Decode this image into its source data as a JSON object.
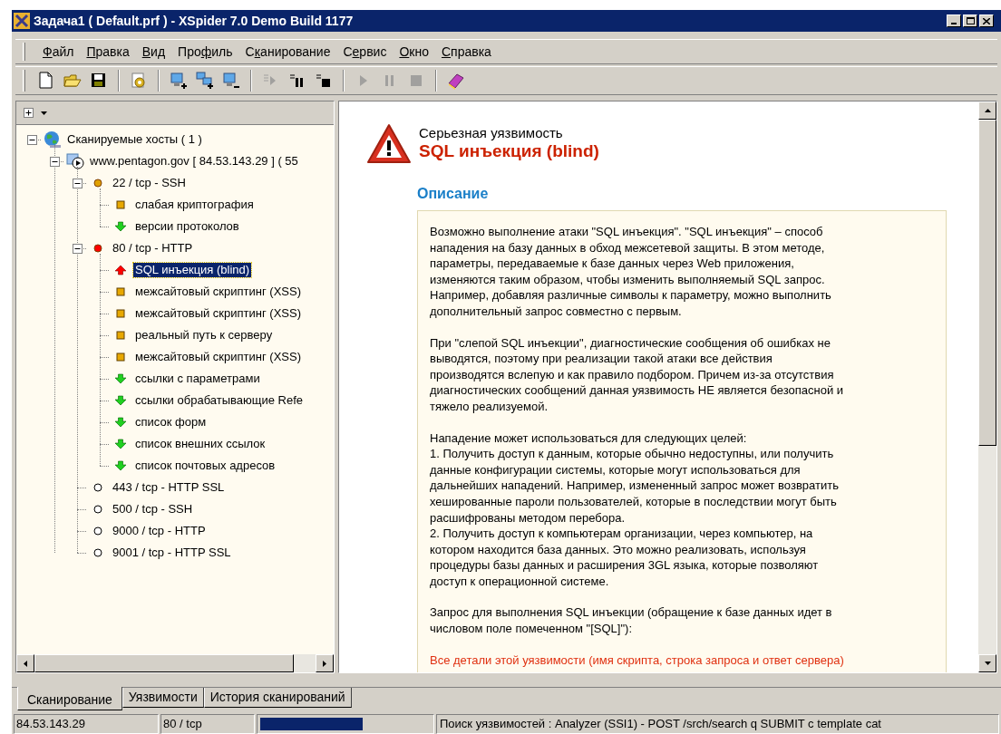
{
  "window": {
    "title": "Задача1 ( Default.prf ) - XSpider 7.0 Demo Build 1177"
  },
  "menu": [
    {
      "key": "Ф",
      "post": "айл"
    },
    {
      "key": "П",
      "post": "равка"
    },
    {
      "key": "В",
      "post": "ид"
    },
    {
      "pre": "Про",
      "key": "ф",
      "post": "иль"
    },
    {
      "pre": "С",
      "key": "к",
      "post": "анирование"
    },
    {
      "pre": "С",
      "key": "е",
      "post": "рвис"
    },
    {
      "key": "О",
      "post": "кно"
    },
    {
      "key": "С",
      "post": "правка"
    }
  ],
  "toolbar": [
    {
      "kind": "new",
      "disabled": false
    },
    {
      "kind": "open",
      "disabled": false
    },
    {
      "kind": "save",
      "disabled": false
    },
    {
      "kind": "sep"
    },
    {
      "kind": "profile",
      "disabled": false
    },
    {
      "kind": "sep"
    },
    {
      "kind": "add-host",
      "disabled": false
    },
    {
      "kind": "add-hosts",
      "disabled": false
    },
    {
      "kind": "remove-host",
      "disabled": false
    },
    {
      "kind": "sep"
    },
    {
      "kind": "queue-start",
      "disabled": true
    },
    {
      "kind": "queue-pause",
      "disabled": false
    },
    {
      "kind": "queue-stop",
      "disabled": false
    },
    {
      "kind": "sep"
    },
    {
      "kind": "play",
      "disabled": true
    },
    {
      "kind": "pause",
      "disabled": true
    },
    {
      "kind": "stop",
      "disabled": true
    },
    {
      "kind": "sep"
    },
    {
      "kind": "help",
      "disabled": false
    }
  ],
  "tree": [
    {
      "kind": "hosts",
      "label": "Сканируемые хосты ( 1 )",
      "selected": false,
      "expanded": true,
      "children": [
        {
          "kind": "host",
          "label": "www.pentagon.gov [ 84.53.143.29 ] ( 55",
          "selected": false,
          "expanded": true,
          "children": [
            {
              "kind": "port",
              "color": "#e0a000",
              "label": "22 / tcp - SSH",
              "selected": false,
              "expanded": true,
              "children": [
                {
                  "kind": "medium",
                  "label": "слабая криптография",
                  "selected": false
                },
                {
                  "kind": "info",
                  "label": "версии протоколов",
                  "selected": false
                }
              ]
            },
            {
              "kind": "port",
              "color": "#ff0000",
              "label": "80 / tcp - HTTP",
              "selected": false,
              "expanded": true,
              "children": [
                {
                  "kind": "high",
                  "label": "SQL инъекция (blind)",
                  "selected": true
                },
                {
                  "kind": "medium",
                  "label": "межсайтовый скриптинг (XSS)",
                  "selected": false
                },
                {
                  "kind": "medium",
                  "label": "межсайтовый скриптинг (XSS)",
                  "selected": false
                },
                {
                  "kind": "medium",
                  "label": "реальный путь к серверу",
                  "selected": false
                },
                {
                  "kind": "medium",
                  "label": "межсайтовый скриптинг (XSS)",
                  "selected": false
                },
                {
                  "kind": "info",
                  "label": "ссылки с параметрами",
                  "selected": false
                },
                {
                  "kind": "info",
                  "label": "ссылки обрабатывающие Refe",
                  "selected": false
                },
                {
                  "kind": "info",
                  "label": "список форм",
                  "selected": false
                },
                {
                  "kind": "info",
                  "label": "список внешних ссылок",
                  "selected": false
                },
                {
                  "kind": "info",
                  "label": "список почтовых адресов",
                  "selected": false
                }
              ]
            },
            {
              "kind": "port",
              "color": "#ffffff",
              "label": "443 / tcp - HTTP SSL",
              "selected": false
            },
            {
              "kind": "port",
              "color": "#ffffff",
              "label": "500 / tcp - SSH",
              "selected": false
            },
            {
              "kind": "port",
              "color": "#ffffff",
              "label": "9000 / tcp - HTTP",
              "selected": false
            },
            {
              "kind": "port",
              "color": "#ffffff",
              "label": "9001 / tcp - HTTP SSL",
              "selected": false
            }
          ]
        }
      ]
    }
  ],
  "details": {
    "severity": "Серьезная уязвимость",
    "title": "SQL инъекция (blind)",
    "section": "Описание",
    "paragraphs": [
      {
        "kind": "normal",
        "text": "Возможно выполнение атаки \"SQL инъекция\". \"SQL инъекция\" – способ\nнападения на базу данных в обход межсетевой защиты. В этом методе,\nпараметры, передаваемые к базе данных через Web приложения,\nизменяются таким образом, чтобы изменить выполняемый SQL запрос.\nНапример, добавляя различные символы к параметру, можно выполнить\nдополнительный запрос совместно с первым."
      },
      {
        "kind": "normal",
        "text": "При \"слепой SQL инъекции\", диагностические сообщения об ошибках не\nвыводятся, поэтому при реализации такой атаки все действия\nпроизводятся вслепую и как правило подбором. Причем из-за отсутствия\nдиагностических сообщений данная уязвимость НЕ является безопасной и\nтяжело реализуемой."
      },
      {
        "kind": "normal",
        "text": "Нападение может использоваться для следующих целей:\n1. Получить доступ к данным, которые обычно недоступны, или получить\nданные конфигурации системы, которые могут использоваться для\nдальнейших нападений. Например, измененный запрос может возвратить\nхешированные пароли пользователей, которые в последствии могут быть\nрасшифрованы методом перебора.\n2. Получить доступ к компьютерам организации, через компьютер, на\nкотором находится база данных. Это можно реализовать, используя\nпроцедуры базы данных и расширения 3GL языка, которые позволяют\nдоступ к операционной системе."
      },
      {
        "kind": "normal",
        "text": "Запрос для выполнения SQL инъекции (обращение к базе данных идет в\nчисловом поле помеченном \"[SQL]\"):"
      },
      {
        "kind": "warning",
        "text": "Все детали этой уязвимости (имя скрипта, строка запроса и ответ сервера)"
      }
    ]
  },
  "tabs": [
    {
      "label": "Сканирование",
      "selected": true
    },
    {
      "label": "Уязвимости",
      "selected": false
    },
    {
      "label": "История сканирований",
      "selected": false
    }
  ],
  "status_bar": {
    "address": "84.53.143.29",
    "port": "80 / tcp",
    "progress": {
      "level": 0.6
    },
    "message": "Поиск уязвимостей : Analyzer (SSI1) - POST /srch/search q SUBMIT c template cat"
  }
}
